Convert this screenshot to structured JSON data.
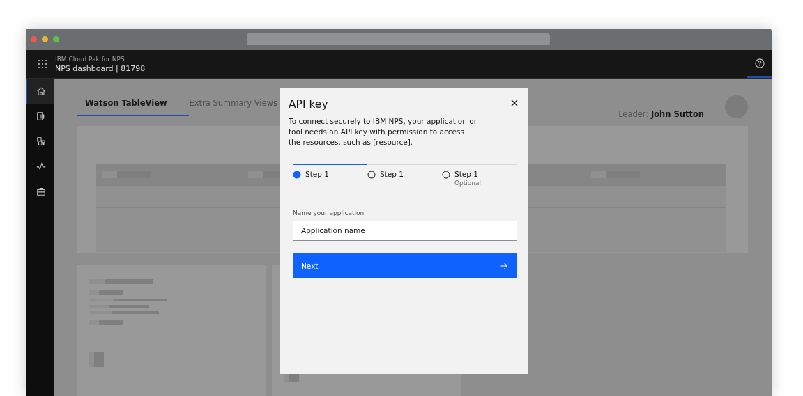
{
  "header": {
    "product": "IBM Cloud Pak for NPS",
    "title": "NPS dashboard | 81798"
  },
  "sidebar": {
    "items": [
      {
        "kind": "home",
        "selected": true
      },
      {
        "kind": "columns",
        "selected": false
      },
      {
        "kind": "blocks",
        "selected": false
      },
      {
        "kind": "pulse",
        "selected": false
      },
      {
        "kind": "briefcase",
        "selected": false
      }
    ]
  },
  "tabs": [
    {
      "label": "Watson TableView",
      "selected": true
    },
    {
      "label": "Extra Summary Views",
      "selected": false
    }
  ],
  "leader": {
    "label": "Leader:",
    "name": "John Sutton"
  },
  "modal": {
    "title": "API key",
    "description": "To connect securely to IBM NPS, your application or tool needs an API key with permission to access the resources, such as [resource].",
    "steps": [
      {
        "label": "Step 1",
        "selected": true
      },
      {
        "label": "Step 1",
        "selected": false
      },
      {
        "label": "Step 1",
        "selected": false,
        "note": "Optional"
      }
    ],
    "field": {
      "label": "Name your application",
      "value": "Application name"
    },
    "button": "Next"
  }
}
